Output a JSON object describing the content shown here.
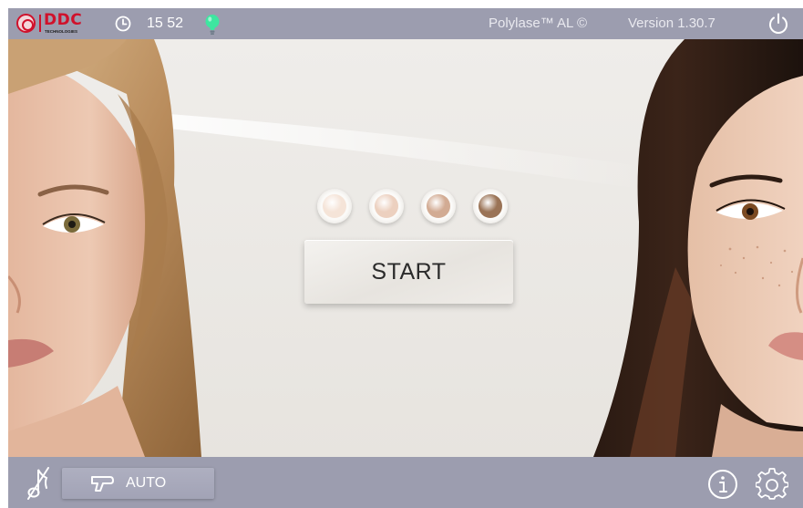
{
  "header": {
    "logo_text": "DDC",
    "logo_subtext": "TECHNOLOGIES",
    "time": "15 52",
    "product": "Polylase™ AL ©",
    "version": "Version 1.30.7"
  },
  "main": {
    "skin_tones": [
      {
        "color": "#f5e4d8"
      },
      {
        "color": "#ecd0bf"
      },
      {
        "color": "#d2ab93"
      },
      {
        "color": "#9a7356"
      }
    ],
    "start_label": "START"
  },
  "footer": {
    "mode_label": "AUTO"
  },
  "colors": {
    "bar": "#9c9daf",
    "background": "#ebe8e4",
    "status_light": "#3ee6a0",
    "brand_red": "#d0112b"
  },
  "icons": [
    "clock-icon",
    "bulb-icon",
    "power-icon",
    "music-icon",
    "handpiece-icon",
    "info-icon",
    "gear-icon"
  ]
}
